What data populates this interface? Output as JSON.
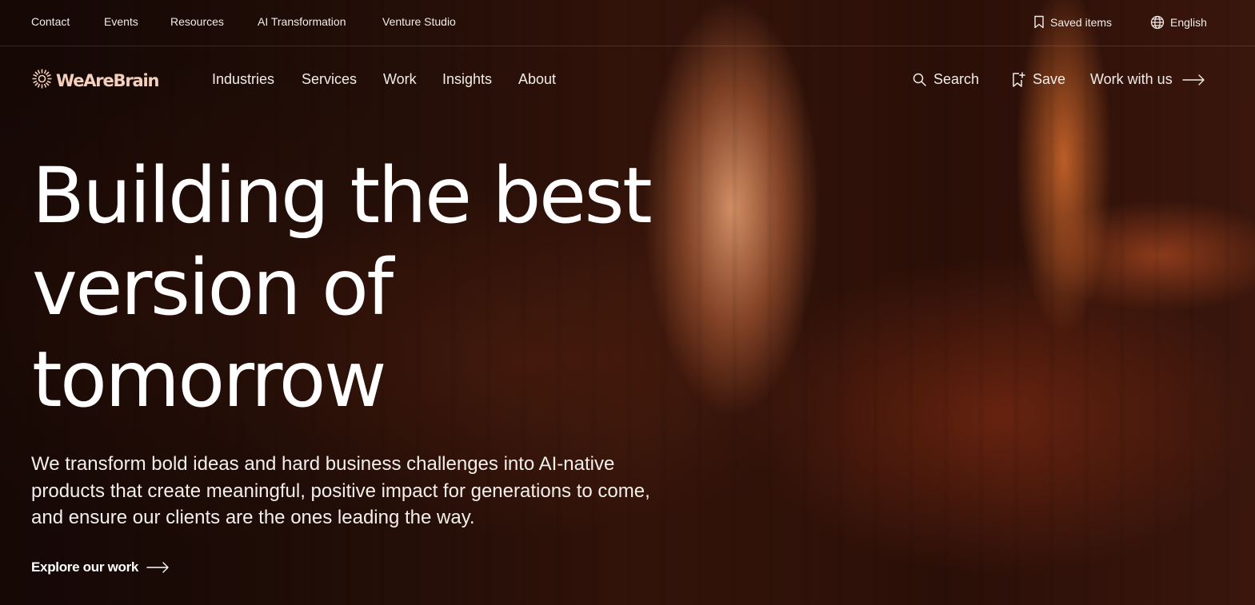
{
  "utility_nav": {
    "links": [
      "Contact",
      "Events",
      "Resources",
      "AI Transformation",
      "Venture Studio"
    ],
    "saved_items": "Saved items",
    "language": "English"
  },
  "main_nav": {
    "logo_text": "WeAreBrain",
    "links": [
      "Industries",
      "Services",
      "Work",
      "Insights",
      "About"
    ],
    "search": "Search",
    "save": "Save",
    "cta": "Work with us"
  },
  "hero": {
    "title_lines": [
      "Building the best",
      "version of",
      "tomorrow"
    ],
    "description": "We transform bold ideas and hard business challenges into AI-native products that create meaningful, positive impact for generations to come, and ensure our clients are the ones leading the way.",
    "cta": "Explore our work"
  },
  "colors": {
    "logo": "#f4d0bd",
    "text": "#ffffff",
    "background": "#1a0b07",
    "accent_glow": "#e0783c"
  }
}
